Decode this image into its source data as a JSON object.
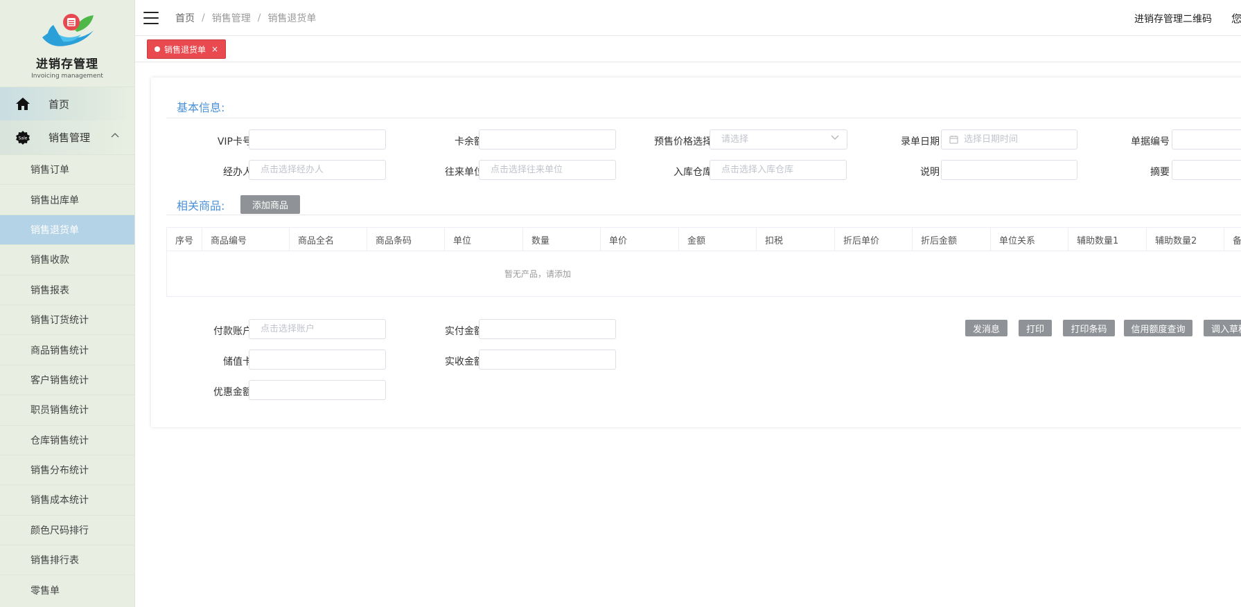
{
  "logo": {
    "title": "进销存管理",
    "subtitle": "Invoicing management"
  },
  "sidebar": {
    "home_label": "首页",
    "group_label": "销售管理",
    "items": [
      {
        "label": "销售订单",
        "active": false
      },
      {
        "label": "销售出库单",
        "active": false
      },
      {
        "label": "销售退货单",
        "active": true
      },
      {
        "label": "销售收款",
        "active": false
      },
      {
        "label": "销售报表",
        "active": false
      },
      {
        "label": "销售订货统计",
        "active": false
      },
      {
        "label": "商品销售统计",
        "active": false
      },
      {
        "label": "客户销售统计",
        "active": false
      },
      {
        "label": "职员销售统计",
        "active": false
      },
      {
        "label": "仓库销售统计",
        "active": false
      },
      {
        "label": "销售分布统计",
        "active": false
      },
      {
        "label": "销售成本统计",
        "active": false
      },
      {
        "label": "颜色尺码排行",
        "active": false
      },
      {
        "label": "销售排行表",
        "active": false
      },
      {
        "label": "零售单",
        "active": false
      }
    ]
  },
  "header": {
    "breadcrumb": [
      "首页",
      "销售管理",
      "销售退货单"
    ],
    "right_link": "进销存管理二维码",
    "edge_text": "您"
  },
  "tab": {
    "label": "销售退货单",
    "close": "×"
  },
  "basic": {
    "title": "基本信息:",
    "vip_label": "VIP卡号",
    "vip_value": "",
    "balance_label": "卡余额",
    "balance_value": "",
    "price_label": "预售价格选择",
    "price_placeholder": "请选择",
    "date_label": "录单日期",
    "date_placeholder": "选择日期时间",
    "docno_label": "单据编号",
    "docno_value": "",
    "handler_label": "经办人",
    "handler_placeholder": "点击选择经办人",
    "partner_label": "往来单位",
    "partner_placeholder": "点击选择往来单位",
    "warehouse_label": "入库仓库",
    "warehouse_placeholder": "点击选择入库仓库",
    "note_label": "说明",
    "note_value": "",
    "summary_label": "摘要",
    "summary_value": ""
  },
  "goods": {
    "title": "相关商品:",
    "add_label": "添加商品",
    "columns": [
      "序号",
      "商品编号",
      "商品全名",
      "商品条码",
      "单位",
      "数量",
      "单价",
      "金额",
      "扣税",
      "折后单价",
      "折后金额",
      "单位关系",
      "辅助数量1",
      "辅助数量2",
      "备"
    ],
    "empty_text": "暂无产品，请添加"
  },
  "payment": {
    "account_label": "付款账户",
    "account_placeholder": "点击选择账户",
    "paid_label": "实付金额",
    "paid_value": "",
    "card_label": "储值卡",
    "card_value": "",
    "received_label": "实收金额",
    "received_value": "",
    "discount_label": "优惠金额",
    "discount_value": ""
  },
  "actions": [
    "发消息",
    "打印",
    "打印条码",
    "信用额度查询",
    "调入草稿"
  ],
  "colors": {
    "accent": "#4a90d6",
    "tab_red": "#e84a4f",
    "active_item": "#b5d3e6",
    "sidebar_bg": "#e8efe2"
  }
}
